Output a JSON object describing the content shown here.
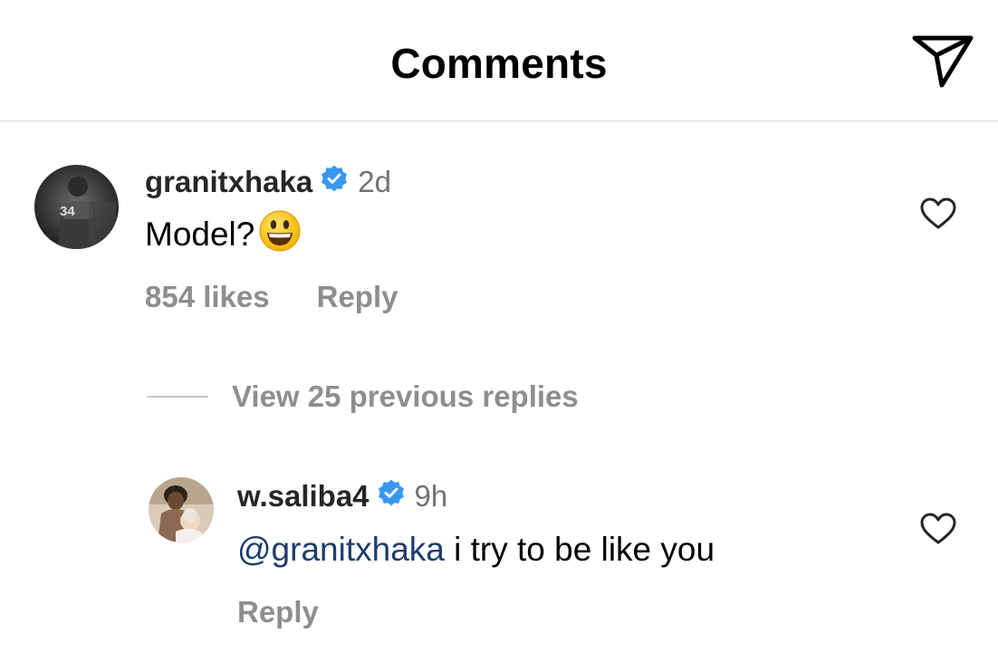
{
  "header": {
    "title": "Comments",
    "share_icon": "paper-plane-icon"
  },
  "comments": [
    {
      "username": "granitxhaka",
      "verified": true,
      "time": "2d",
      "text": "Model?",
      "emoji": "😃",
      "likes": "854 likes",
      "reply_label": "Reply",
      "view_replies": "View 25 previous replies"
    }
  ],
  "replies": [
    {
      "username": "w.saliba4",
      "verified": true,
      "time": "9h",
      "mention": "@granitxhaka",
      "text": " i try to be like you",
      "reply_label": "Reply"
    }
  ],
  "colors": {
    "verified": "#3897f0",
    "mention": "#1d3d6b",
    "meta_text": "#8e8e8e",
    "divider": "#dbdbdb"
  }
}
